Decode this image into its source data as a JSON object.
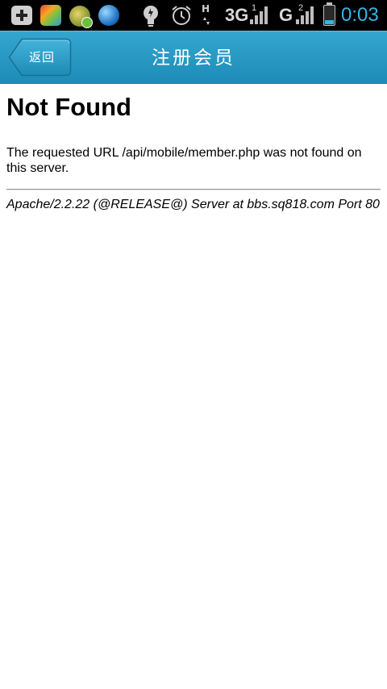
{
  "status_bar": {
    "icons": [
      "add-icon",
      "app-icon",
      "app-icon",
      "globe-icon",
      "bulb-icon",
      "alarm-icon"
    ],
    "network_h": "H",
    "network_3g": "3G",
    "sim1": "1",
    "network_g": "G",
    "sim2": "2",
    "time": "0:03",
    "time_color": "#33b5e5"
  },
  "header": {
    "back_label": "返回",
    "title": "注册会员",
    "background": "#2799c4"
  },
  "page": {
    "title": "Not Found",
    "message": "The requested URL /api/mobile/member.php was not found on this server.",
    "signature": "Apache/2.2.22 (@RELEASE@) Server at bbs.sq818.com Port 80"
  }
}
